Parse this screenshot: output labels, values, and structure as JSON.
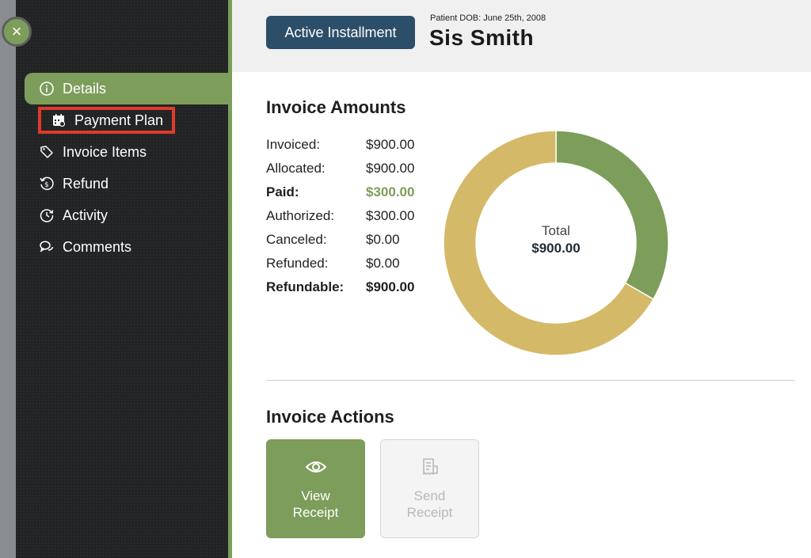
{
  "close_button": {
    "glyph": "×"
  },
  "sidebar": {
    "items": [
      {
        "label": "Details",
        "icon": "info-icon",
        "active": true
      },
      {
        "label": "Payment Plan",
        "icon": "calendar-icon",
        "highlighted": true
      },
      {
        "label": "Invoice Items",
        "icon": "tag-icon"
      },
      {
        "label": "Refund",
        "icon": "refund-icon"
      },
      {
        "label": "Activity",
        "icon": "activity-icon"
      },
      {
        "label": "Comments",
        "icon": "comments-icon"
      }
    ]
  },
  "header": {
    "status_label": "Active Installment",
    "dob": "Patient DOB: June 25th, 2008",
    "patient_name": "Sis Smith"
  },
  "invoice_amounts": {
    "title": "Invoice Amounts",
    "rows": [
      {
        "label": "Invoiced:",
        "value": "$900.00"
      },
      {
        "label": "Allocated:",
        "value": "$900.00"
      },
      {
        "label": "Paid:",
        "value": "$300.00"
      },
      {
        "label": "Authorized:",
        "value": "$300.00"
      },
      {
        "label": "Canceled:",
        "value": "$0.00"
      },
      {
        "label": "Refunded:",
        "value": "$0.00"
      },
      {
        "label": "Refundable:",
        "value": "$900.00"
      }
    ]
  },
  "chart_data": {
    "type": "pie",
    "slices": [
      {
        "value": 300,
        "color": "#7d9d5a"
      },
      {
        "value": 600,
        "color": "#d4b968"
      }
    ],
    "center_label": "Total",
    "center_value": "$900.00"
  },
  "invoice_actions": {
    "title": "Invoice Actions",
    "view_receipt": {
      "line1": "View",
      "line2": "Receipt",
      "icon": "eye-icon"
    },
    "send_receipt": {
      "line1": "Send",
      "line2": "Receipt",
      "icon": "receipt-icon"
    }
  },
  "colors": {
    "accent_green": "#7d9d5a",
    "accent_gold": "#d4b968",
    "header_button": "#2c4e68",
    "highlight_red": "#e03a2a"
  }
}
